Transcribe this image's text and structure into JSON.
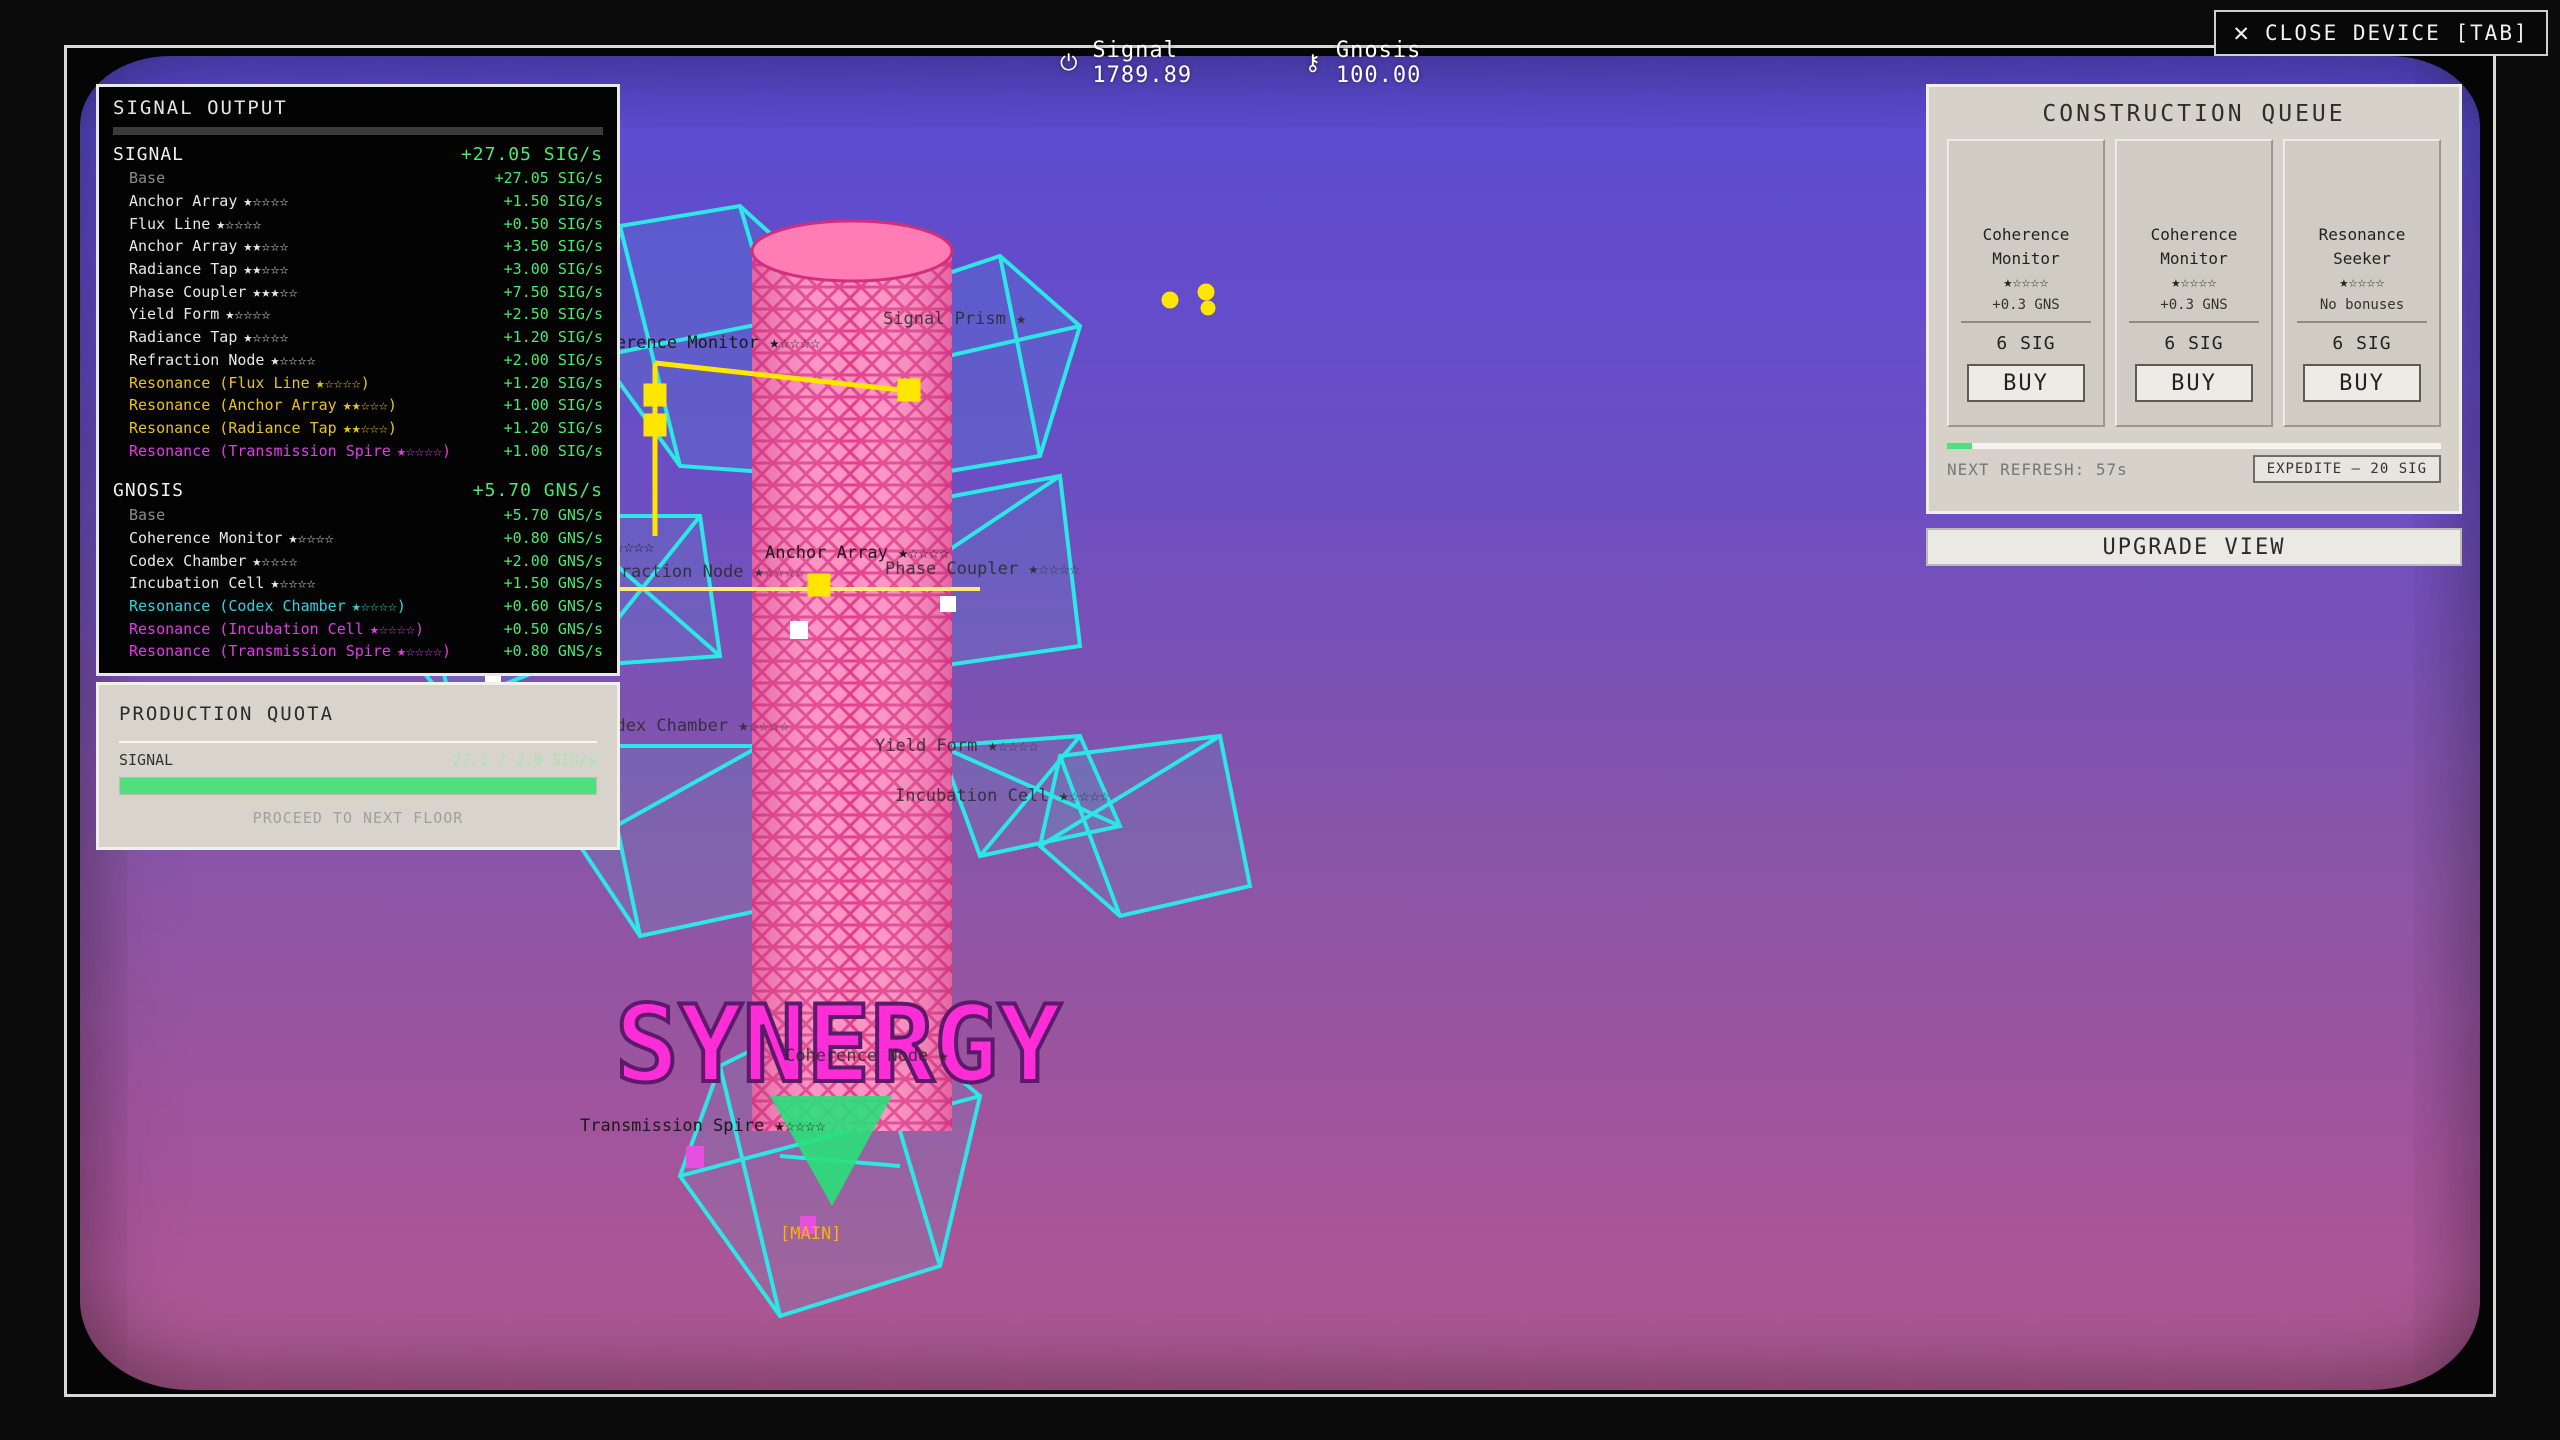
{
  "close_device": {
    "icon": "close-icon",
    "label": "CLOSE DEVICE [TAB]"
  },
  "resources": {
    "signal_icon": "power-icon",
    "signal_text": "Signal 1789.89",
    "gnosis_icon": "key-icon",
    "gnosis_text": "Gnosis 100.00"
  },
  "signal_output": {
    "title": "SIGNAL OUTPUT",
    "signal": {
      "name": "SIGNAL",
      "total": "+27.05 SIG/s",
      "rows": [
        {
          "label": "Base",
          "stars": "",
          "value": "+27.05 SIG/s",
          "kind": "base"
        },
        {
          "label": "Anchor Array",
          "stars": "★☆☆☆☆",
          "value": "+1.50 SIG/s",
          "kind": "normal"
        },
        {
          "label": "Flux Line",
          "stars": "★☆☆☆☆",
          "value": "+0.50 SIG/s",
          "kind": "normal"
        },
        {
          "label": "Anchor Array",
          "stars": "★★☆☆☆",
          "value": "+3.50 SIG/s",
          "kind": "normal"
        },
        {
          "label": "Radiance Tap",
          "stars": "★★☆☆☆",
          "value": "+3.00 SIG/s",
          "kind": "normal"
        },
        {
          "label": "Phase Coupler",
          "stars": "★★★☆☆",
          "value": "+7.50 SIG/s",
          "kind": "normal"
        },
        {
          "label": "Yield Form",
          "stars": "★☆☆☆☆",
          "value": "+2.50 SIG/s",
          "kind": "normal"
        },
        {
          "label": "Radiance Tap",
          "stars": "★☆☆☆☆",
          "value": "+1.20 SIG/s",
          "kind": "normal"
        },
        {
          "label": "Refraction Node",
          "stars": "★☆☆☆☆",
          "value": "+2.00 SIG/s",
          "kind": "normal"
        },
        {
          "label": "Resonance (Flux Line",
          "stars": "★☆☆☆☆)",
          "value": "+1.20 SIG/s",
          "kind": "yellow"
        },
        {
          "label": "Resonance (Anchor Array",
          "stars": "★★☆☆☆)",
          "value": "+1.00 SIG/s",
          "kind": "yellow"
        },
        {
          "label": "Resonance (Radiance Tap",
          "stars": "★★☆☆☆)",
          "value": "+1.20 SIG/s",
          "kind": "yellow"
        },
        {
          "label": "Resonance (Transmission Spire",
          "stars": "★☆☆☆☆)",
          "value": "+1.00 SIG/s",
          "kind": "magenta"
        }
      ]
    },
    "gnosis": {
      "name": "GNOSIS",
      "total": "+5.70 GNS/s",
      "rows": [
        {
          "label": "Base",
          "stars": "",
          "value": "+5.70 GNS/s",
          "kind": "base"
        },
        {
          "label": "Coherence Monitor",
          "stars": "★☆☆☆☆",
          "value": "+0.80 GNS/s",
          "kind": "normal"
        },
        {
          "label": "Codex Chamber",
          "stars": "★☆☆☆☆",
          "value": "+2.00 GNS/s",
          "kind": "normal"
        },
        {
          "label": "Incubation Cell",
          "stars": "★☆☆☆☆",
          "value": "+1.50 GNS/s",
          "kind": "normal"
        },
        {
          "label": "Resonance (Codex Chamber",
          "stars": "★☆☆☆☆)",
          "value": "+0.60 GNS/s",
          "kind": "cyan"
        },
        {
          "label": "Resonance (Incubation Cell",
          "stars": "★☆☆☆☆)",
          "value": "+0.50 GNS/s",
          "kind": "magenta"
        },
        {
          "label": "Resonance (Transmission Spire",
          "stars": "★☆☆☆☆)",
          "value": "+0.80 GNS/s",
          "kind": "magenta"
        }
      ]
    }
  },
  "production_quota": {
    "title": "PRODUCTION QUOTA",
    "label": "SIGNAL",
    "value": "27.1 / 2.0 SIG/s",
    "progress": 1.0,
    "next_floor": "PROCEED TO NEXT FLOOR"
  },
  "construction_queue": {
    "title": "CONSTRUCTION QUEUE",
    "cards": [
      {
        "name_line1": "Coherence",
        "name_line2": "Monitor",
        "stars": "★☆☆☆☆",
        "bonus": "+0.3 GNS",
        "cost": "6 SIG",
        "buy": "BUY"
      },
      {
        "name_line1": "Coherence",
        "name_line2": "Monitor",
        "stars": "★☆☆☆☆",
        "bonus": "+0.3 GNS",
        "cost": "6 SIG",
        "buy": "BUY"
      },
      {
        "name_line1": "Resonance",
        "name_line2": "Seeker",
        "stars": "★☆☆☆☆",
        "bonus": "No bonuses",
        "cost": "6 SIG",
        "buy": "BUY"
      }
    ],
    "refresh_text": "NEXT REFRESH: 57s",
    "refresh_progress": 0.05,
    "expedite": "EXPEDITE — 20 SIG"
  },
  "upgrade_view": "UPGRADE VIEW",
  "scene": {
    "synergy": "SYNERGY",
    "labels": {
      "coherence_monitor": "Coherence Monitor ★☆☆☆☆",
      "signal_prism": "Signal Prism ★",
      "radiance_tap": "Radiance Tap ★☆☆☆☆",
      "anchor_array": "Anchor Array ★☆☆☆☆",
      "phase_coupler": "Phase Coupler ★☆☆☆☆",
      "refraction_node": "Refraction Node ★☆☆☆☆",
      "codex_chamber": "Codex Chamber ★☆☆☆☆",
      "yield_form": "Yield Form ★☆☆☆☆",
      "incubation_cell": "Incubation Cell ★☆☆☆☆",
      "coherence_node": "Coherence Node ★",
      "transmission_spire": "Transmission Spire ★☆☆☆☆",
      "main": "[MAIN]"
    },
    "colors": {
      "tower": "#ff6aa8",
      "wire": "#2ee6e6",
      "node": "#ffe600",
      "spire": "#29e07a",
      "synergy": "#ff2dd8"
    }
  }
}
